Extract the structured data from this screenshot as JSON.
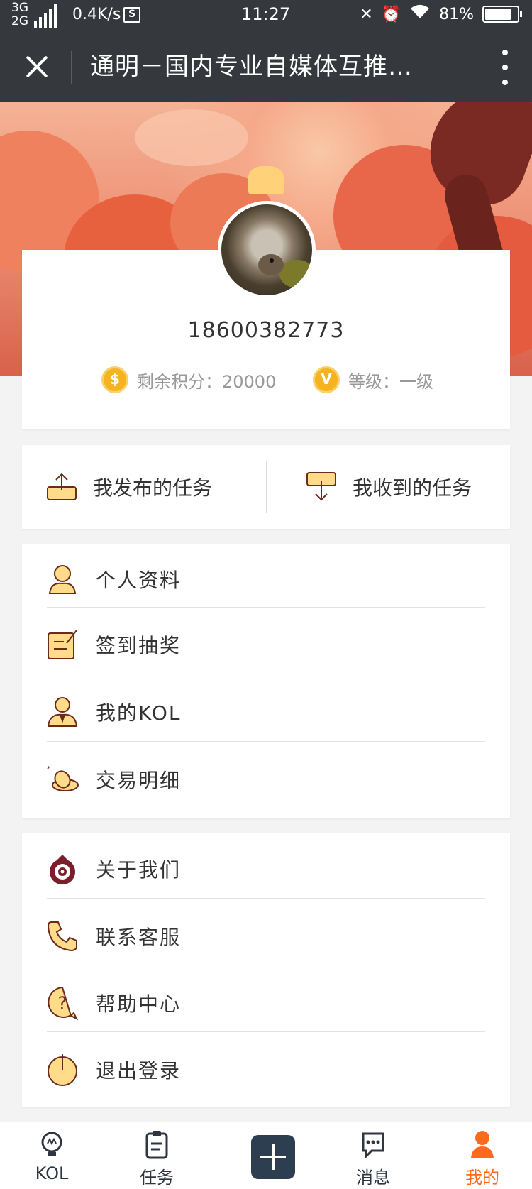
{
  "status_bar": {
    "network_1": "3G",
    "network_2": "2G",
    "speed": "0.4K/s",
    "speed_icon": "S",
    "time": "11:27",
    "battery": "81%",
    "icons": [
      "mute-icon",
      "alarm-icon",
      "wifi-icon"
    ]
  },
  "title_bar": {
    "title": "通明－国内专业自媒体互推…"
  },
  "profile": {
    "phone": "18600382773",
    "points_icon": "$",
    "points_text": "剩余积分：20000",
    "level_icon": "V",
    "level_text": "等级：一级"
  },
  "tasks": {
    "published": "我发布的任务",
    "received": "我收到的任务"
  },
  "menu_group_1": [
    {
      "label": "个人资料",
      "icon": "user-profile-icon"
    },
    {
      "label": "签到抽奖",
      "icon": "sign-in-icon"
    },
    {
      "label": "我的KOL",
      "icon": "kol-person-icon"
    },
    {
      "label": "交易明细",
      "icon": "coins-icon"
    }
  ],
  "menu_group_2": [
    {
      "label": "关于我们",
      "icon": "about-icon"
    },
    {
      "label": "联系客服",
      "icon": "phone-icon"
    },
    {
      "label": "帮助中心",
      "icon": "help-icon"
    },
    {
      "label": "退出登录",
      "icon": "power-icon"
    }
  ],
  "bottom_nav": {
    "kol": "KOL",
    "task": "任务",
    "message": "消息",
    "mine": "我的"
  },
  "colors": {
    "title_bar_bg": "#35393d",
    "accent": "#ff6a1a",
    "icon_fill": "#ffdb8a",
    "icon_stroke": "#6b2a1a",
    "badge": "#f5b321"
  }
}
